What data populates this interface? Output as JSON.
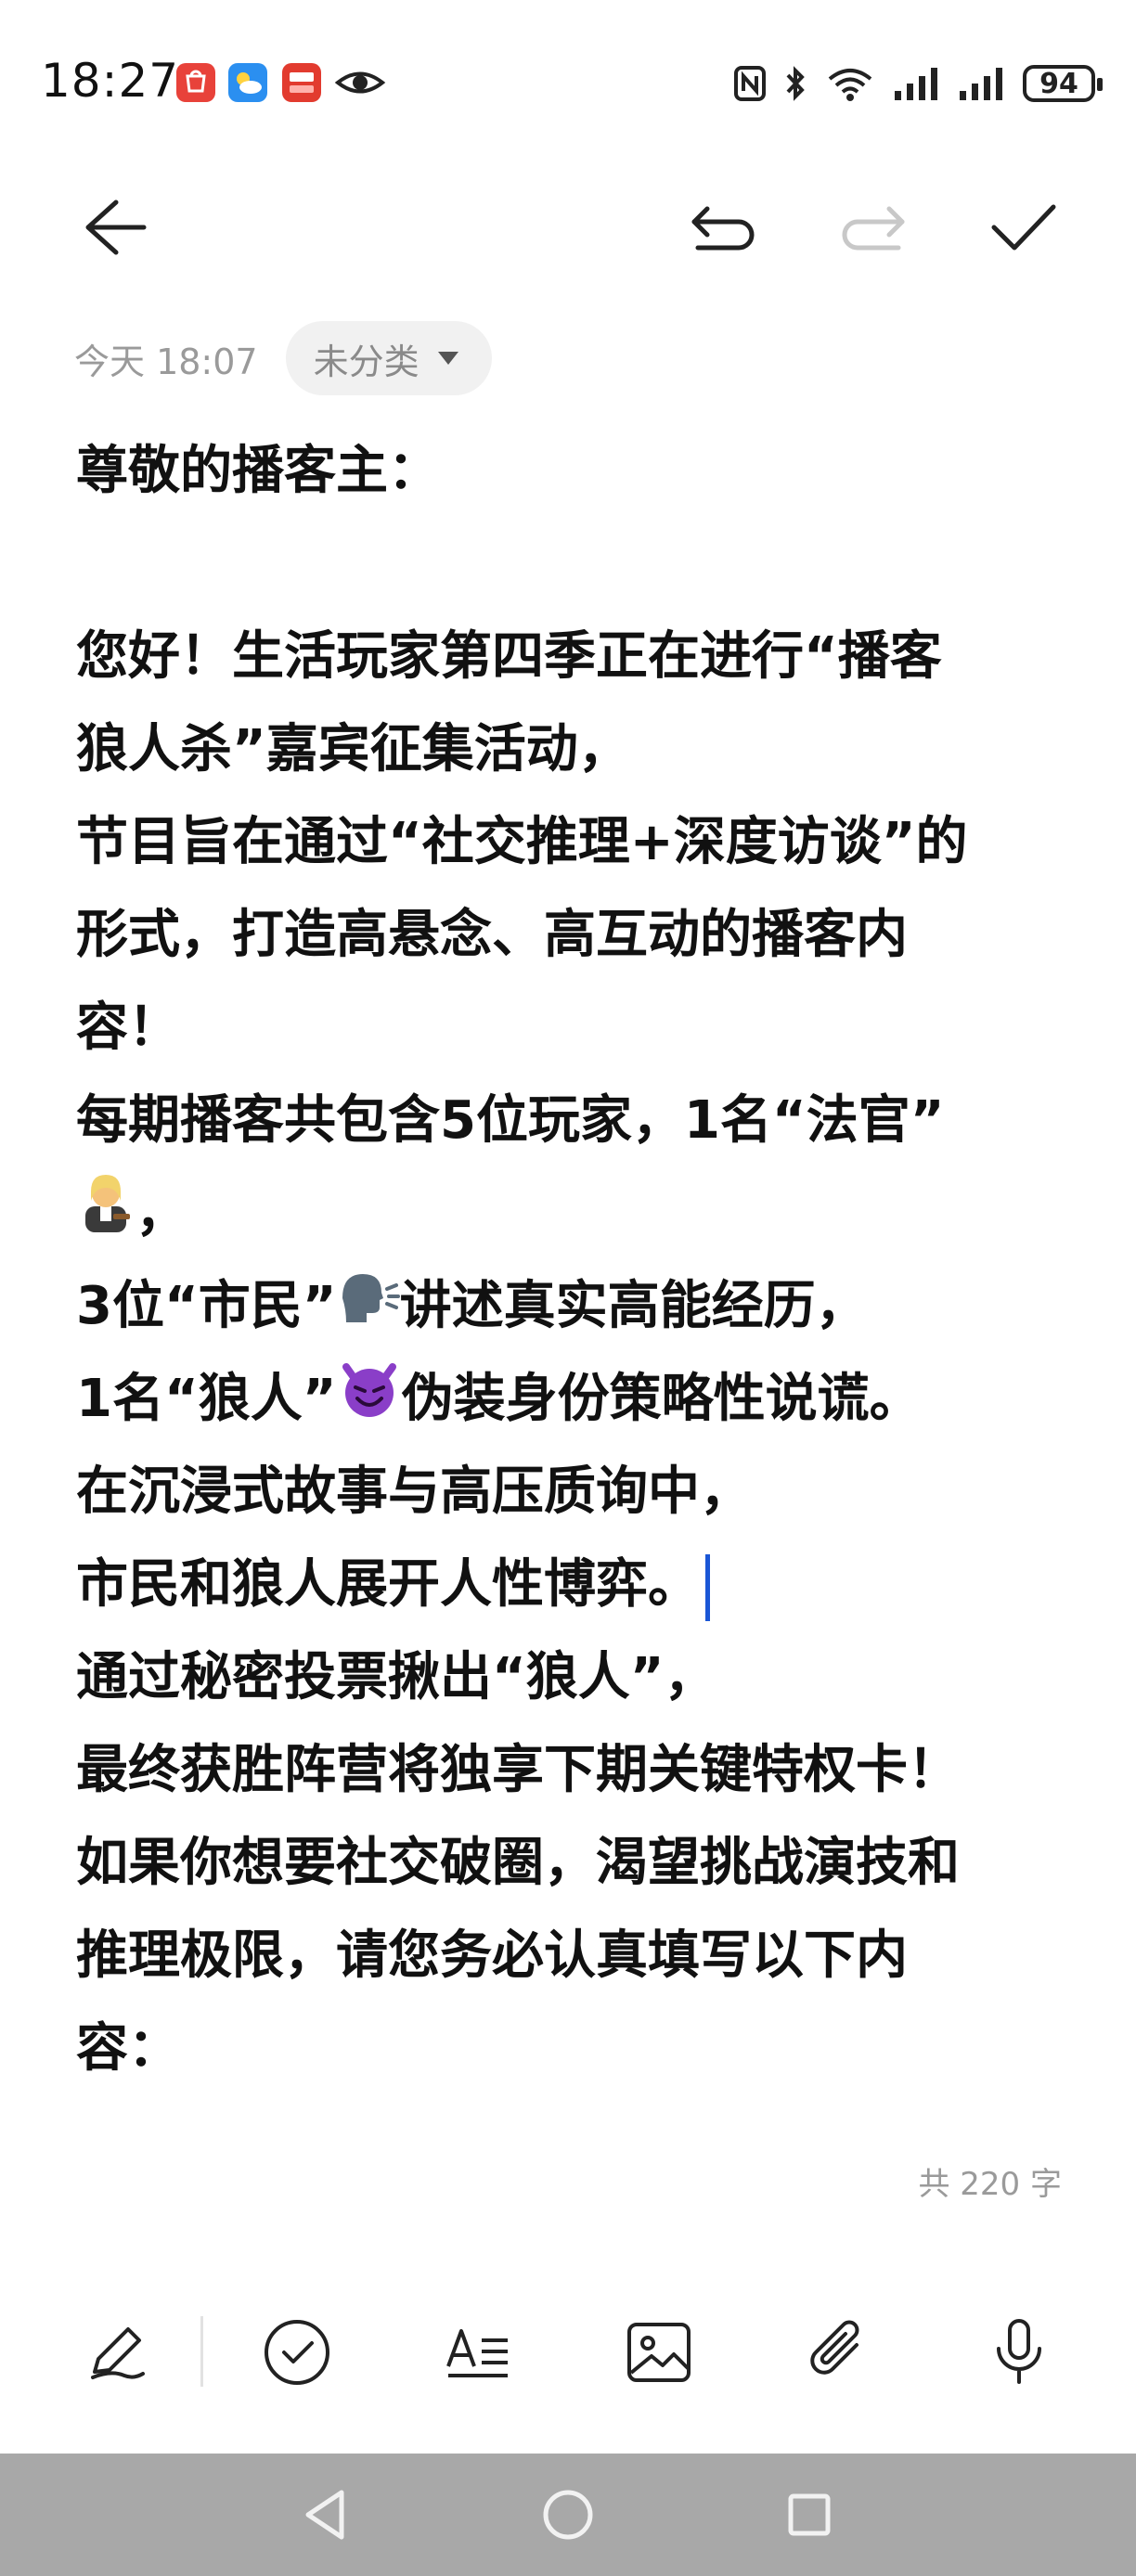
{
  "status_bar": {
    "time": "18:27",
    "battery": "94",
    "app_icons": [
      "huawei-store-icon",
      "weather-icon",
      "cloud-pay-icon",
      "eye-icon"
    ],
    "status_icons": [
      "nfc-icon",
      "bluetooth-icon",
      "wifi-icon",
      "signal-icon",
      "signal-icon",
      "battery-icon"
    ]
  },
  "toolbar": {
    "back": "back-arrow-icon",
    "undo": "undo-icon",
    "redo": "redo-icon",
    "done": "check-icon"
  },
  "note": {
    "date": "今天 18:07",
    "category": "未分类",
    "lines": {
      "l1": "尊敬的播客主：",
      "l3": "您好！生活玩家第四季正在进行“播客",
      "l4": "狼人杀”嘉宾征集活动，",
      "l5": "节目旨在通过“社交推理+深度访谈”的",
      "l6": "形式，打造高悬念、高互动的播客内",
      "l7": "容！",
      "l8": "每期播客共包含5位玩家，1名“法官”",
      "l9b": "，",
      "l10a": "3位“市民”",
      "l10b": "讲述真实高能经历，",
      "l11a": "1名“狼人”",
      "l11b": "伪装身份策略性说谎。",
      "l12": "在沉浸式故事与高压质询中，",
      "l13": "市民和狼人展开人性博弈。",
      "l14": "通过秘密投票揪出“狼人”，",
      "l15": "最终获胜阵营将独享下期关键特权卡！",
      "l16": "如果你想要社交破圈，渴望挑战演技和",
      "l17": "推理极限，请您务必认真填写以下内",
      "l18": "容："
    },
    "word_count": "共 220 字"
  },
  "edit_toolbar": [
    "pen-icon",
    "checklist-icon",
    "text-format-icon",
    "image-icon",
    "attachment-icon",
    "microphone-icon"
  ],
  "nav_bar": [
    "nav-back-icon",
    "nav-home-icon",
    "nav-recents-icon"
  ],
  "colors": {
    "cursor": "#1a56d6",
    "navbar": "#a8a8a8",
    "meta": "#9a9a9a"
  }
}
